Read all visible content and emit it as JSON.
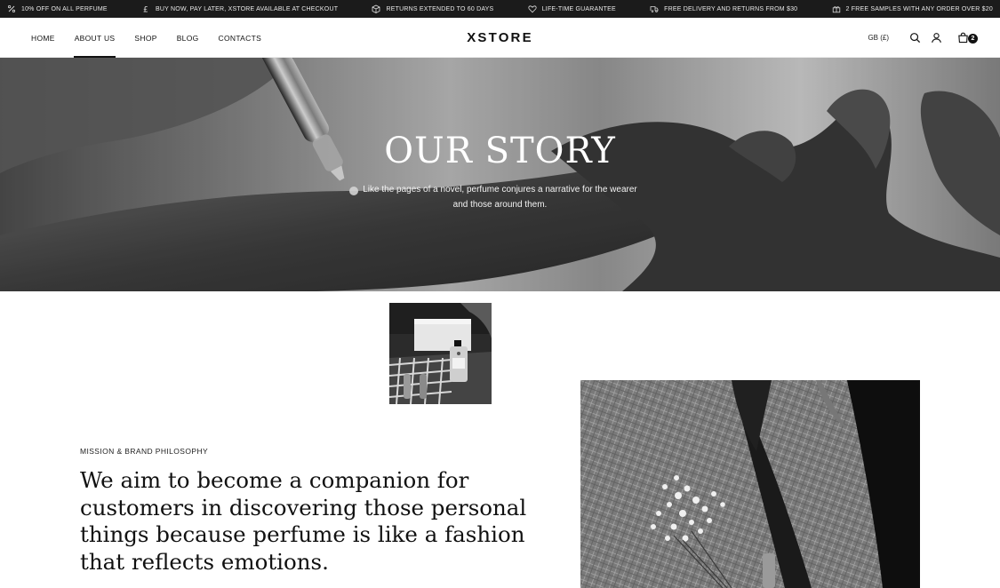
{
  "promo_bar": {
    "items": [
      {
        "icon": "percent-icon",
        "text": "10% OFF ON ALL PERFUME"
      },
      {
        "icon": "pound-icon",
        "text": "BUY NOW, PAY LATER, XSTORE AVAILABLE AT CHECKOUT"
      },
      {
        "icon": "box-icon",
        "text": "RETURNS EXTENDED TO 60 DAYS"
      },
      {
        "icon": "heart-icon",
        "text": "LIFE-TIME GUARANTEE"
      },
      {
        "icon": "truck-icon",
        "text": "FREE DELIVERY AND RETURNS FROM $30"
      },
      {
        "icon": "gift-icon",
        "text": "2 FREE SAMPLES WITH ANY ORDER OVER $20"
      }
    ]
  },
  "header": {
    "nav": [
      {
        "label": "HOME",
        "active": false
      },
      {
        "label": "ABOUT US",
        "active": true
      },
      {
        "label": "SHOP",
        "active": false
      },
      {
        "label": "BLOG",
        "active": false
      },
      {
        "label": "CONTACTS",
        "active": false
      }
    ],
    "logo": "XSTORE",
    "currency": "GB (£)",
    "icons": [
      "search-icon",
      "user-icon",
      "cart-icon"
    ],
    "cart_count": "2"
  },
  "hero": {
    "title": "OUR STORY",
    "subtitle_lines": [
      "Like the pages of a novel, perfume conjures a narrative for the wearer",
      "and those around them."
    ]
  },
  "content": {
    "eyebrow": "MISSION & BRAND PHILOSOPHY",
    "mission_lines": [
      "We aim to become a companion for",
      "customers in discovering those personal",
      "things because perfume is like a fashion",
      "that reflects emotions."
    ]
  },
  "colors": {
    "promo_bg": "#1b1b1b",
    "text": "#111111",
    "background": "#ffffff"
  }
}
